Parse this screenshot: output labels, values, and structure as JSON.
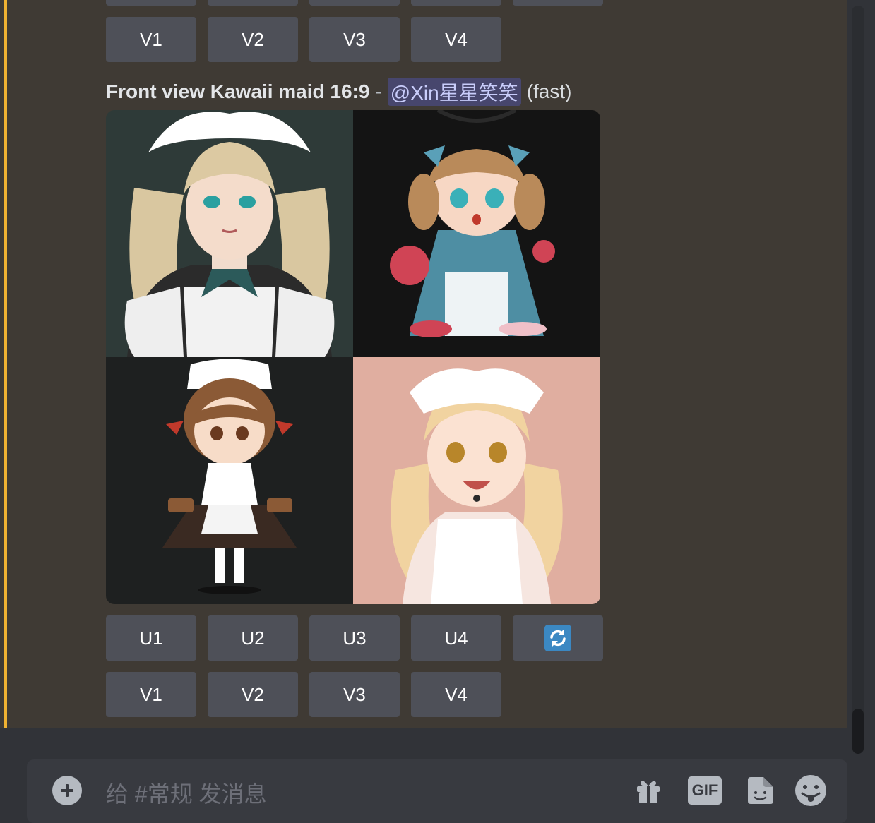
{
  "previous_message": {
    "variation_buttons": [
      "V1",
      "V2",
      "V3",
      "V4"
    ]
  },
  "message": {
    "prompt": "Front view Kawaii maid 16:9",
    "separator": "-",
    "mention": "@Xin星星笑笑",
    "speed": "(fast)",
    "upscale_buttons": [
      "U1",
      "U2",
      "U3",
      "U4"
    ],
    "reroll_icon": "refresh-icon",
    "variation_buttons": [
      "V1",
      "V2",
      "V3",
      "V4"
    ]
  },
  "composer": {
    "placeholder": "给 #常规 发消息",
    "gif_label": "GIF"
  },
  "colors": {
    "mention_highlight": "#f0b232",
    "button": "#4e5058",
    "reroll": "#3b88c3"
  }
}
